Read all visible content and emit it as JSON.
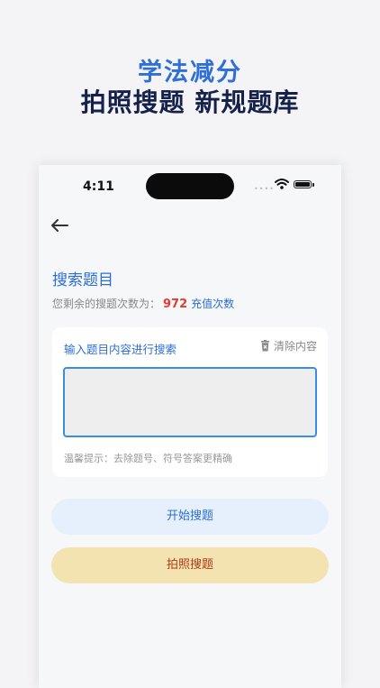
{
  "headline": {
    "line1": "学法减分",
    "line2": "拍照搜题 新规题库"
  },
  "status_bar": {
    "time": "4:11",
    "signal": "••••"
  },
  "page": {
    "title": "搜索题目",
    "remaining_label": "您剩余的搜题次数为：",
    "remaining_count": "972",
    "recharge_link": "充值次数"
  },
  "search_card": {
    "label": "输入题目内容进行搜索",
    "clear_label": "清除内容",
    "input_value": "",
    "hint": "温馨提示：去除题号、符号答案更精确"
  },
  "buttons": {
    "start_search": "开始搜题",
    "photo_search": "拍照搜题"
  },
  "colors": {
    "accent": "#2a6ed8",
    "count_red": "#e23b30",
    "photo_button_bg": "#f2e3b0"
  }
}
